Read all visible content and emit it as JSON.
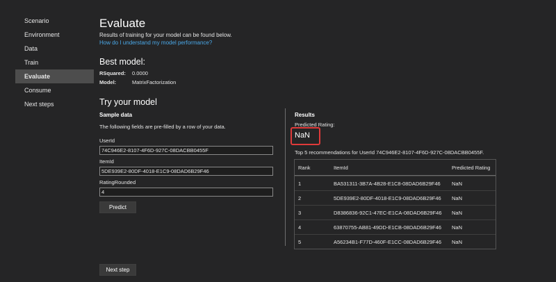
{
  "sidebar": {
    "items": [
      {
        "label": "Scenario"
      },
      {
        "label": "Environment"
      },
      {
        "label": "Data"
      },
      {
        "label": "Train"
      },
      {
        "label": "Evaluate"
      },
      {
        "label": "Consume"
      },
      {
        "label": "Next steps"
      }
    ],
    "active_index": 4
  },
  "main": {
    "title": "Evaluate",
    "description": "Results of training for your model can be found below.",
    "help_link": "How do I understand my model performance?",
    "best_model": {
      "heading": "Best model:",
      "rsquared_label": "RSquared:",
      "rsquared_value": "0.0000",
      "model_label": "Model:",
      "model_value": "MatrixFactorization"
    },
    "try_model": {
      "heading": "Try your model",
      "sample_heading": "Sample data",
      "sample_desc": "The following fields are pre-filled by a row of your data.",
      "fields": [
        {
          "label": "UserId",
          "value": "74C946E2-8107-4F6D-927C-08DACBB0455F"
        },
        {
          "label": "ItemId",
          "value": "5DE939E2-80DF-4018-E1C9-08DAD6B29F46"
        },
        {
          "label": "RatingRounded",
          "value": "4"
        }
      ],
      "predict_label": "Predict"
    },
    "results": {
      "heading": "Results",
      "predicted_label": "Predicted Rating:",
      "predicted_value": "NaN",
      "top_caption": "Top 5 recommendations for UserId 74C946E2-8107-4F6D-927C-08DACBB0455F.",
      "columns": [
        "Rank",
        "ItemId",
        "Predicted Rating"
      ],
      "rows": [
        [
          "1",
          "BA531311-3B7A-4B28-E1C8-08DAD6B29F46",
          "NaN"
        ],
        [
          "2",
          "5DE939E2-80DF-4018-E1C9-08DAD6B29F46",
          "NaN"
        ],
        [
          "3",
          "D8386836-92C1-47EC-E1CA-08DAD6B29F46",
          "NaN"
        ],
        [
          "4",
          "63870755-AB81-49DD-E1CB-08DAD6B29F46",
          "NaN"
        ],
        [
          "5",
          "A56234B1-F77D-460F-E1CC-08DAD6B29F46",
          "NaN"
        ]
      ]
    },
    "next_step_label": "Next step"
  }
}
